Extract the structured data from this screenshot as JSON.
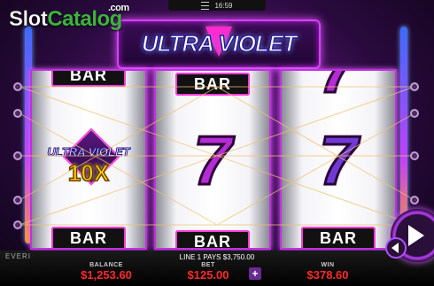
{
  "topbar": {
    "time": "16:59"
  },
  "watermark": {
    "slot": "Slot",
    "catalog": "Catalog",
    "com": ".com"
  },
  "logo": {
    "text": "ULTRA VIOLET"
  },
  "reels": {
    "reel1": {
      "top_symbol": "BAR",
      "wild_text": "ULTRA VIOLET",
      "wild_multiplier": "10X",
      "bottom_symbol": "BAR"
    },
    "reel2": {
      "top_symbol": "BAR",
      "middle_symbol": "7",
      "bottom_symbol": "BAR"
    },
    "reel3": {
      "top_symbol": "7",
      "middle_symbol": "7",
      "bottom_symbol": "BAR"
    }
  },
  "footer": {
    "brand": "EVERI",
    "line_pays": "LINE 1 PAYS $3,750.00",
    "balance_label": "BALANCE",
    "balance_value": "$1,253.60",
    "bet_label": "BET",
    "bet_value": "$125.00",
    "win_label": "WIN",
    "win_value": "$378.60"
  },
  "colors": {
    "accent": "#c040ff",
    "meter_value": "#ff2a2a",
    "watermark_green": "#3cb43c"
  }
}
